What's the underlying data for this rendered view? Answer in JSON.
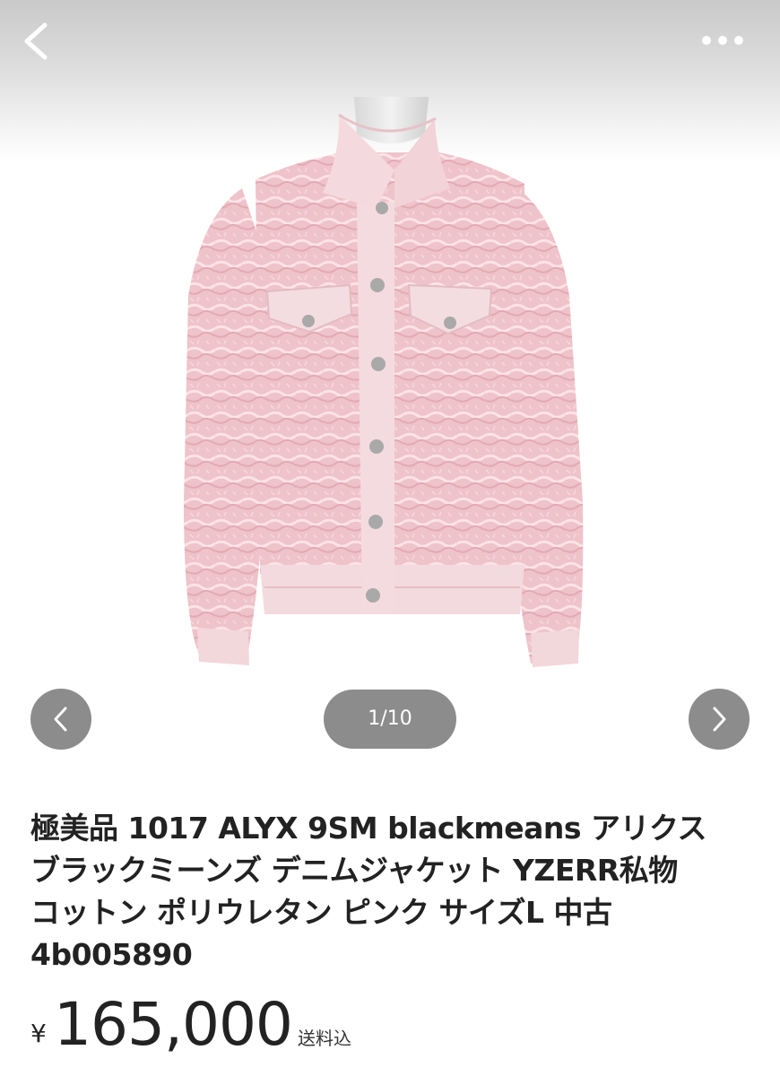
{
  "header": {
    "back_icon": "chevron-left-icon",
    "more_icon": "more-horizontal-icon"
  },
  "gallery": {
    "prev_icon": "chevron-left-icon",
    "next_icon": "chevron-right-icon",
    "counter": "1/10",
    "current": 1,
    "total": 10
  },
  "product": {
    "title_lines": [
      "極美品 1017 ALYX 9SM blackmeans アリクス",
      "ブラックミーンズ デニムジャケット YZERR私物",
      "コットン ポリウレタン ピンク サイズL 中古",
      "4b005890"
    ],
    "currency_symbol": "¥",
    "price": "165,000",
    "shipping_note": "送料込"
  },
  "colors": {
    "header_gradient": "#c9c9c9",
    "nav_button_bg": "#8c8c8c",
    "jacket_pink": "#f0c9cf",
    "text": "#222222"
  }
}
